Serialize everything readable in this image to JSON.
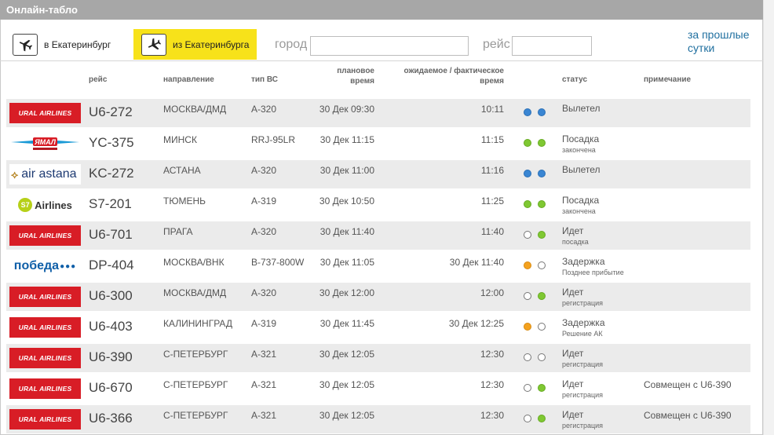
{
  "title": "Онлайн-табло",
  "direction_to": {
    "label": "в Екатеринбург"
  },
  "direction_from": {
    "label": "из Екатеринбурга"
  },
  "filters": {
    "city_label": "город",
    "city_value": "",
    "flight_label": "рейс",
    "flight_value": ""
  },
  "past_link": "за прошлые сутки",
  "headers": {
    "flight": "рейс",
    "destination": "направление",
    "aircraft": "тип ВС",
    "scheduled_1": "плановое",
    "scheduled_2": "время",
    "actual_1": "ожидаемое / фактическое",
    "actual_2": "время",
    "status": "статус",
    "note": "примечание"
  },
  "colors": {
    "blue": "#3a86d3",
    "green": "#7fc832",
    "orange": "#f4a21f",
    "empty": "#ffffff",
    "ural_red": "#d81d26",
    "highlight_yellow": "#f7e21a"
  },
  "airline_logos": {
    "ural": "URAL AIRLINES",
    "yamal": "ЯМАЛ",
    "astana": "air astana",
    "s7": "Airlines",
    "s7_mark": "S7",
    "pobeda": "победа"
  },
  "flights": [
    {
      "airline": "ural",
      "flight": "U6-272",
      "destination": "МОСКВА/ДМД",
      "aircraft": "A-320",
      "scheduled": "30 Дек 09:30",
      "actual": "10:11",
      "dot1": "blue",
      "dot2": "blue",
      "status": "Вылетел",
      "substatus": "",
      "note": ""
    },
    {
      "airline": "yamal",
      "flight": "YC-375",
      "destination": "МИНСК",
      "aircraft": "RRJ-95LR",
      "scheduled": "30 Дек 11:15",
      "actual": "11:15",
      "dot1": "green",
      "dot2": "green",
      "status": "Посадка",
      "substatus": "закончена",
      "note": ""
    },
    {
      "airline": "astana",
      "flight": "KC-272",
      "destination": "АСТАНА",
      "aircraft": "A-320",
      "scheduled": "30 Дек 11:00",
      "actual": "11:16",
      "dot1": "blue",
      "dot2": "blue",
      "status": "Вылетел",
      "substatus": "",
      "note": ""
    },
    {
      "airline": "s7",
      "flight": "S7-201",
      "destination": "ТЮМЕНЬ",
      "aircraft": "A-319",
      "scheduled": "30 Дек 10:50",
      "actual": "11:25",
      "dot1": "green",
      "dot2": "green",
      "status": "Посадка",
      "substatus": "закончена",
      "note": ""
    },
    {
      "airline": "ural",
      "flight": "U6-701",
      "destination": "ПРАГА",
      "aircraft": "A-320",
      "scheduled": "30 Дек 11:40",
      "actual": "11:40",
      "dot1": "empty",
      "dot2": "green",
      "status": "Идет",
      "substatus": "посадка",
      "note": ""
    },
    {
      "airline": "pobeda",
      "flight": "DP-404",
      "destination": "МОСКВА/ВНК",
      "aircraft": "B-737-800W",
      "scheduled": "30 Дек 11:05",
      "actual": "30 Дек 11:40",
      "dot1": "orange",
      "dot2": "empty",
      "status": "Задержка",
      "substatus": "Позднее прибытие",
      "note": ""
    },
    {
      "airline": "ural",
      "flight": "U6-300",
      "destination": "МОСКВА/ДМД",
      "aircraft": "A-320",
      "scheduled": "30 Дек 12:00",
      "actual": "12:00",
      "dot1": "empty",
      "dot2": "green",
      "status": "Идет",
      "substatus": "регистрация",
      "note": ""
    },
    {
      "airline": "ural",
      "flight": "U6-403",
      "destination": "КАЛИНИНГРАД",
      "aircraft": "A-319",
      "scheduled": "30 Дек 11:45",
      "actual": "30 Дек 12:25",
      "dot1": "orange",
      "dot2": "empty",
      "status": "Задержка",
      "substatus": "Решение АК",
      "note": ""
    },
    {
      "airline": "ural",
      "flight": "U6-390",
      "destination": "С-ПЕТЕРБУРГ",
      "aircraft": "A-321",
      "scheduled": "30 Дек 12:05",
      "actual": "12:30",
      "dot1": "empty",
      "dot2": "empty",
      "status": "Идет",
      "substatus": "регистрация",
      "note": ""
    },
    {
      "airline": "ural",
      "flight": "U6-670",
      "destination": "С-ПЕТЕРБУРГ",
      "aircraft": "A-321",
      "scheduled": "30 Дек 12:05",
      "actual": "12:30",
      "dot1": "empty",
      "dot2": "green",
      "status": "Идет",
      "substatus": "регистрация",
      "note": "Совмещен с U6-390"
    },
    {
      "airline": "ural",
      "flight": "U6-366",
      "destination": "С-ПЕТЕРБУРГ",
      "aircraft": "A-321",
      "scheduled": "30 Дек 12:05",
      "actual": "12:30",
      "dot1": "empty",
      "dot2": "green",
      "status": "Идет",
      "substatus": "регистрация",
      "note": "Совмещен с U6-390"
    }
  ]
}
